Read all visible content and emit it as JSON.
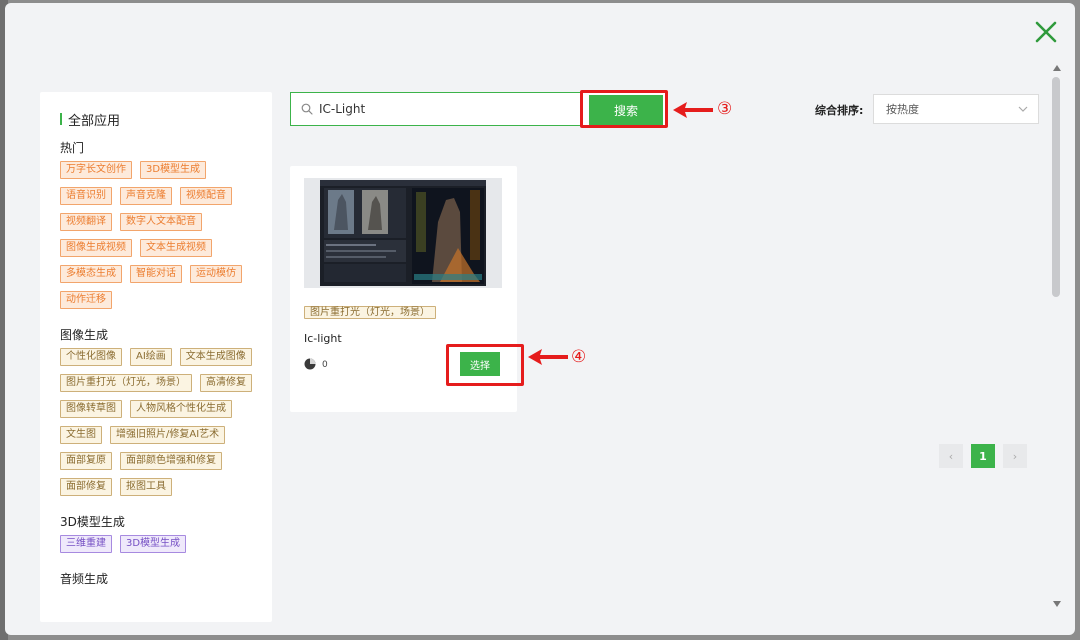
{
  "sidebar": {
    "title": "全部应用",
    "sections": [
      {
        "title": "热门",
        "variant": "hot",
        "tags": [
          "万字长文创作",
          "3D模型生成",
          "语音识别",
          "声音克隆",
          "视频配音",
          "视频翻译",
          "数字人文本配音",
          "图像生成视频",
          "文本生成视频",
          "多模态生成",
          "智能对话",
          "运动模仿",
          "动作迁移"
        ]
      },
      {
        "title": "图像生成",
        "variant": "img",
        "tags": [
          "个性化图像",
          "AI绘画",
          "文本生成图像",
          "图片重打光（灯光，场景）",
          "高清修复",
          "图像转草图",
          "人物风格个性化生成",
          "文生图",
          "增强旧照片/修复AI艺术",
          "面部复原",
          "面部颜色增强和修复",
          "面部修复",
          "抠图工具"
        ]
      },
      {
        "title": "3D模型生成",
        "variant": "model",
        "tags": [
          "三维重建",
          "3D模型生成"
        ]
      },
      {
        "title": "音频生成",
        "variant": "hot",
        "tags": []
      }
    ]
  },
  "search": {
    "value": "IC-Light",
    "button_label": "搜索"
  },
  "sort": {
    "label": "综合排序:",
    "selected": "按热度"
  },
  "card": {
    "tag": "图片重打光（灯光，场景）",
    "name": "Ic-light",
    "usage_count": "0",
    "select_label": "选择"
  },
  "annotations": {
    "search": "③",
    "select": "④"
  },
  "pagination": {
    "prev": "‹",
    "current": "1",
    "next": "›"
  },
  "colors": {
    "accent": "#3cb34a",
    "annotation_red": "#e51c1c"
  }
}
